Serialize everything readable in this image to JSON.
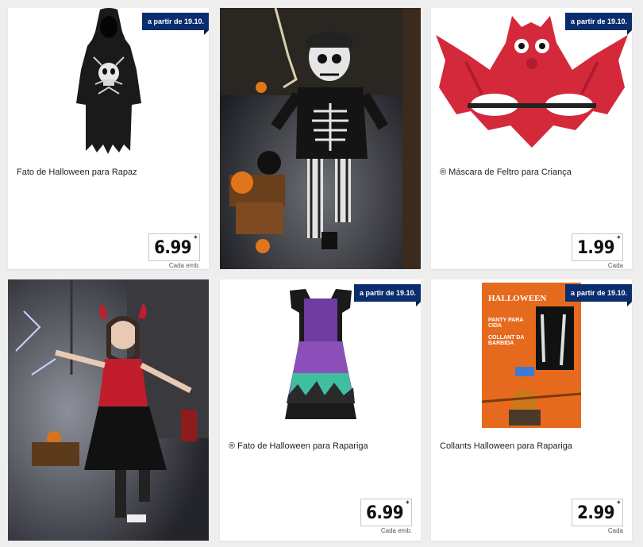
{
  "products": [
    {
      "name": "Fato de Halloween para Rapaz",
      "price": "6.99",
      "unit": "Cada emb.",
      "badge": "a partir de 19.10."
    },
    {
      "name": "® Máscara de Feltro para Criança",
      "price": "1.99",
      "unit": "Cada",
      "badge": "a partir de 19.10."
    },
    {
      "name": "® Fato de Halloween para Rapariga",
      "price": "6.99",
      "unit": "Cada emb.",
      "badge": "a partir de 19.10."
    },
    {
      "name": "Collants Halloween para Rapariga",
      "price": "2.99",
      "unit": "Cada",
      "badge": "a partir de 19.10."
    }
  ],
  "price_star": "*",
  "colors": {
    "badge": "#0a2d6e",
    "page_bg": "#eeeeee",
    "mask_red": "#d4293b"
  },
  "pack_text": {
    "brand": "HALLOWEEN",
    "line1": "PANTY PARA CIDA",
    "line2": "COLLANT DA BARBIDA"
  }
}
